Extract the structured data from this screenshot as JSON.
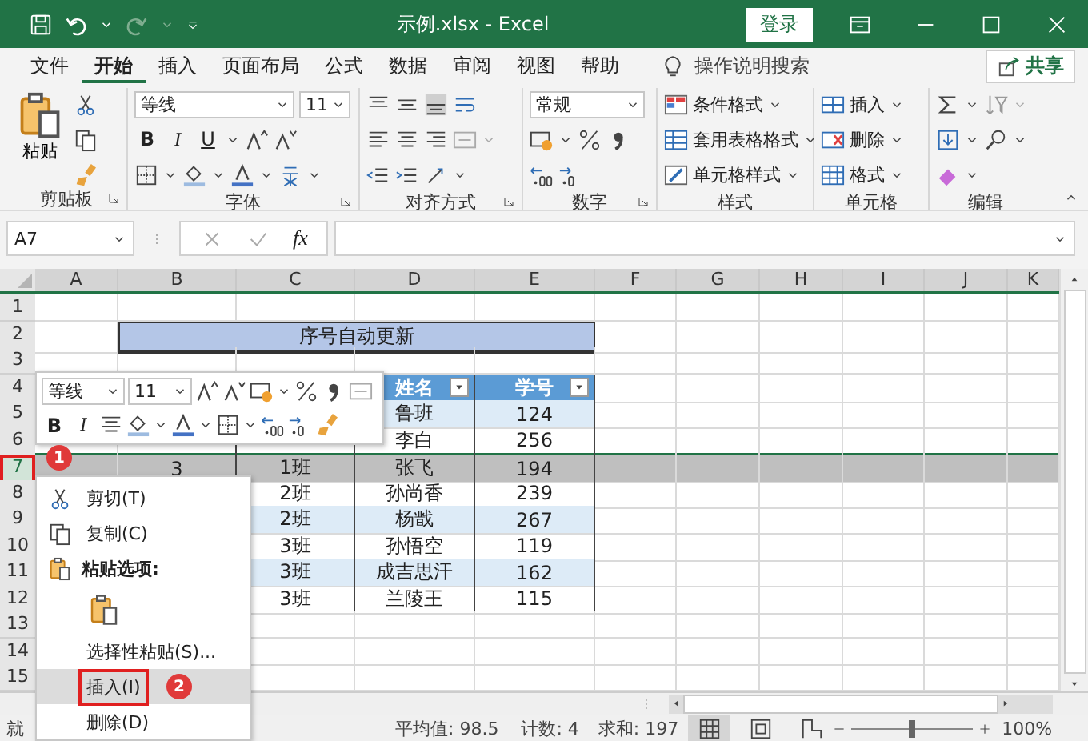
{
  "window": {
    "title": "示例.xlsx  -  Excel",
    "sign_in": "登录"
  },
  "tabs": [
    {
      "label": "文件",
      "selected": false
    },
    {
      "label": "开始",
      "selected": true
    },
    {
      "label": "插入",
      "selected": false
    },
    {
      "label": "页面布局",
      "selected": false
    },
    {
      "label": "公式",
      "selected": false
    },
    {
      "label": "数据",
      "selected": false
    },
    {
      "label": "审阅",
      "selected": false
    },
    {
      "label": "视图",
      "selected": false
    },
    {
      "label": "帮助",
      "selected": false
    }
  ],
  "tell_me": "操作说明搜索",
  "share": "共享",
  "ribbon": {
    "paste": "粘贴",
    "font_name": "等线",
    "font_size": "11",
    "bold": "B",
    "italic": "I",
    "underline": "U",
    "number_format": "常规",
    "styles": [
      "条件格式",
      "套用表格格式",
      "单元格样式"
    ],
    "cells": [
      "插入",
      "删除",
      "格式"
    ],
    "group_labels": [
      "剪贴板",
      "字体",
      "对齐方式",
      "数字",
      "样式",
      "单元格",
      "编辑"
    ]
  },
  "formula_bar": {
    "name_box": "A7",
    "insert_function": "fx"
  },
  "sheet": {
    "columns": [
      "A",
      "B",
      "C",
      "D",
      "E",
      "F",
      "G",
      "H",
      "I",
      "J",
      "K"
    ],
    "rows": [
      {
        "header": "1",
        "kind": "empty",
        "selected": false,
        "annotated": false
      },
      {
        "header": "2",
        "kind": "title",
        "selected": false,
        "annotated": false,
        "cells": [
          {
            "text": "序号自动更新"
          }
        ]
      },
      {
        "header": "3",
        "kind": "empty",
        "selected": false,
        "annotated": false
      },
      {
        "header": "4",
        "kind": "header",
        "selected": false,
        "annotated": false,
        "cells": [
          {
            "text": "姓名",
            "filter": true
          },
          {
            "text": "学号",
            "filter": true
          }
        ]
      },
      {
        "header": "5",
        "kind": "band",
        "selected": false,
        "annotated": false,
        "cells": [
          {
            "text": "鲁班"
          },
          {
            "text": "124"
          }
        ]
      },
      {
        "header": "6",
        "kind": "plain",
        "selected": false,
        "annotated": false,
        "cells": [
          {
            "text": "李白"
          },
          {
            "text": "256"
          }
        ]
      },
      {
        "header": "7",
        "kind": "band",
        "selected": true,
        "annotated": true,
        "cells": [
          {
            "text": "3"
          },
          {
            "text": "1班"
          },
          {
            "text": "张飞"
          },
          {
            "text": "194"
          }
        ]
      },
      {
        "header": "8",
        "kind": "plain",
        "selected": false,
        "annotated": false,
        "cells": [
          {
            "text": "2班"
          },
          {
            "text": "孙尚香"
          },
          {
            "text": "239"
          }
        ]
      },
      {
        "header": "9",
        "kind": "band",
        "selected": false,
        "annotated": false,
        "cells": [
          {
            "text": "2班"
          },
          {
            "text": "杨戬"
          },
          {
            "text": "267"
          }
        ]
      },
      {
        "header": "10",
        "kind": "plain",
        "selected": false,
        "annotated": false,
        "cells": [
          {
            "text": "3班"
          },
          {
            "text": "孙悟空"
          },
          {
            "text": "119"
          }
        ]
      },
      {
        "header": "11",
        "kind": "band",
        "selected": false,
        "annotated": false,
        "cells": [
          {
            "text": "3班"
          },
          {
            "text": "成吉思汗"
          },
          {
            "text": "162"
          }
        ]
      },
      {
        "header": "12",
        "kind": "plain",
        "selected": false,
        "annotated": false,
        "cells": [
          {
            "text": "3班"
          },
          {
            "text": "兰陵王"
          },
          {
            "text": "115"
          }
        ]
      },
      {
        "header": "13",
        "kind": "empty",
        "selected": false,
        "annotated": false
      },
      {
        "header": "14",
        "kind": "empty",
        "selected": false,
        "annotated": false
      },
      {
        "header": "15",
        "kind": "empty",
        "selected": false,
        "annotated": false
      }
    ]
  },
  "mini_toolbar": {
    "font_name": "等线",
    "font_size": "11",
    "bold": "B",
    "italic": "I"
  },
  "context_menu": {
    "items": [
      {
        "kind": "command",
        "label": "剪切(T)",
        "selected": false,
        "annotated": false
      },
      {
        "kind": "command",
        "label": "复制(C)",
        "selected": false,
        "annotated": false
      },
      {
        "kind": "heading",
        "label": "粘贴选项:"
      },
      {
        "kind": "paste_icons"
      },
      {
        "kind": "command",
        "label": "选择性粘贴(S)...",
        "selected": false,
        "annotated": false
      },
      {
        "kind": "command",
        "label": "插入(I)",
        "selected": true,
        "annotated": true
      },
      {
        "kind": "command",
        "label": "删除(D)",
        "selected": false,
        "annotated": false
      }
    ]
  },
  "callouts": [
    "1",
    "2"
  ],
  "status_bar": {
    "mode": "就",
    "average": "平均值: 98.5",
    "count": "计数: 4",
    "sum": "求和: 197",
    "zoom": "100%",
    "zoom_slider": {
      "level": 0.5
    }
  }
}
